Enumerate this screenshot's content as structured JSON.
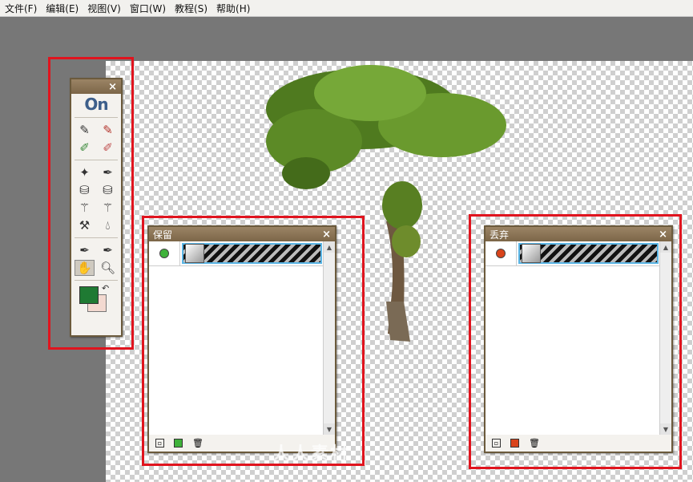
{
  "menubar": {
    "items": [
      "文件(F)",
      "编辑(E)",
      "视图(V)",
      "窗口(W)",
      "教程(S)",
      "帮助(H)"
    ]
  },
  "toolbox": {
    "logo": "On",
    "close": "×"
  },
  "keep_panel": {
    "title": "保留",
    "close": "×",
    "dot_color": "#3fb23a"
  },
  "drop_panel": {
    "title": "丢弃",
    "close": "×",
    "dot_color": "#d9441b"
  },
  "colors": {
    "highlight_box": "#e0141e",
    "foreground_swatch": "#1f7a33",
    "background_swatch": "#f3d9d0"
  },
  "watermark": "人人素材"
}
